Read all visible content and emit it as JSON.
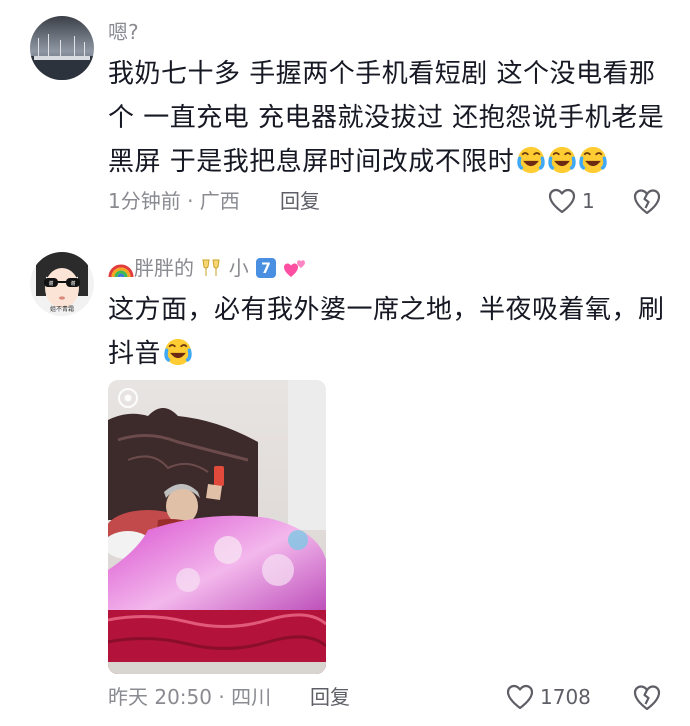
{
  "comments": [
    {
      "username": "嗯?",
      "content_lines": [
        "我奶七十多 手握两个手机看短剧 这个没电看那",
        "个 一直充电 充电器就没拔过 还抱怨说手机老是",
        "黑屏 于是我把息屏时间改成不限时"
      ],
      "emoji_name": "laugh-cry-emoji",
      "emoji_count": 3,
      "time_location": "1分钟前 · 广西",
      "reply_label": "回复",
      "like_count": "1",
      "avatar_icon": "harbor-photo-avatar"
    },
    {
      "username_prefix": "胖胖的",
      "username_middle": "小",
      "username_badge": "7",
      "content_lines": [
        "这方面，必有我外婆一席之地，半夜吸着氧，刷",
        "抖音"
      ],
      "emoji_name": "laugh-cry-emoji",
      "emoji_count": 1,
      "time_location": "昨天 20:50 · 四川",
      "reply_label": "回复",
      "like_count": "1708",
      "avatar_icon": "girl-sunglasses-avatar",
      "avatar_caption": "姐不青霜",
      "photo_icon": "grandma-in-bed-photo"
    }
  ],
  "colors": {
    "text_primary": "#161823",
    "text_secondary": "#8a8b91",
    "badge_blue": "#4a90e2",
    "heart_pink": "#ff4fa3"
  }
}
